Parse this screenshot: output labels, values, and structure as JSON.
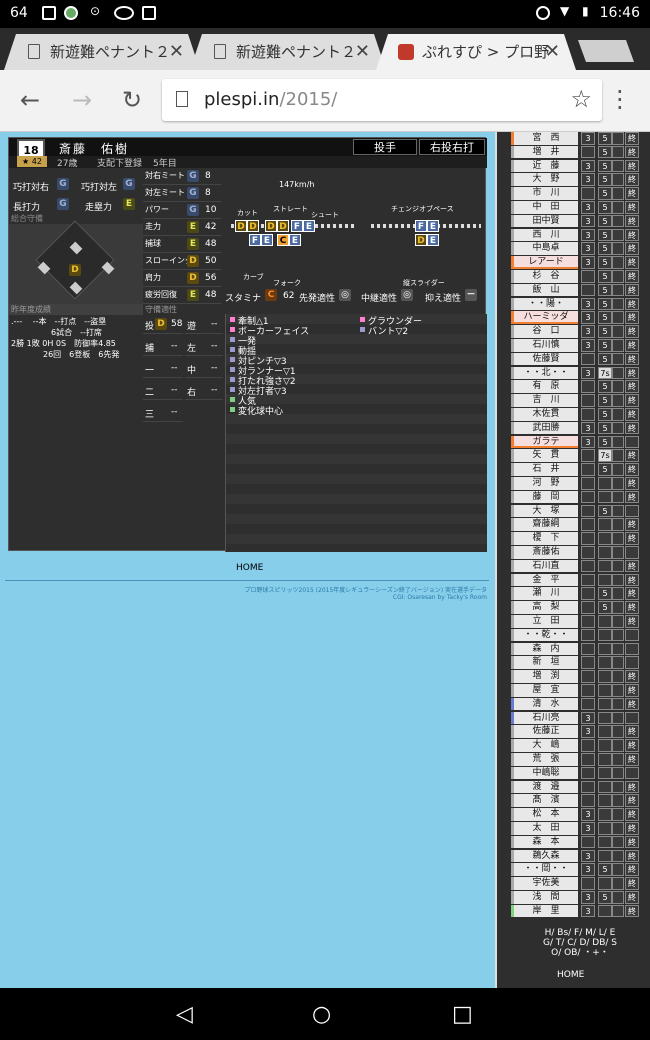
{
  "status": {
    "left": "64",
    "time": "16:46"
  },
  "tabs": [
    {
      "label": "新遊難ペナント２"
    },
    {
      "label": "新遊難ペナント２"
    },
    {
      "label": "ぷれすぴ > プロ野"
    }
  ],
  "url": {
    "host": "plespi.in",
    "path": "/2015/"
  },
  "player": {
    "number": "18",
    "name": "斎藤　佑樹",
    "position": "投手",
    "hand": "右投右打",
    "stars": "★ 42",
    "age": "27歳",
    "reg": "支配下登録",
    "years": "5年目"
  },
  "batting": [
    {
      "label": "巧打対右",
      "grade": "G"
    },
    {
      "label": "巧打対左",
      "grade": "G"
    },
    {
      "label": "長打力",
      "grade": "G"
    },
    {
      "label": "走塁力",
      "grade": "E"
    }
  ],
  "labels": {
    "field": "総合守備",
    "last_year": "昨年度成績",
    "defense_fit": "守備適性",
    "stamina": "スタミナ",
    "starter": "先発適性",
    "reliever": "中継適性",
    "closer": "抑え適性",
    "home": "HOME"
  },
  "record": {
    "l1": ".---　 --本　--打点　--盗塁",
    "l2": "　　　　　6試合　--打席",
    "l3": "2勝 1敗 0H 0S　防御率4.85",
    "l4": "　　　　26回　6登板　6先発"
  },
  "abilities": [
    {
      "label": "対右ミート",
      "grade": "G",
      "value": "8"
    },
    {
      "label": "対左ミート",
      "grade": "G",
      "value": "8"
    },
    {
      "label": "パワー",
      "grade": "G",
      "value": "10"
    },
    {
      "label": "走力",
      "grade": "E",
      "value": "42"
    },
    {
      "label": "捕球",
      "grade": "E",
      "value": "48"
    },
    {
      "label": "スローイング",
      "grade": "D",
      "value": "50"
    },
    {
      "label": "肩力",
      "grade": "D",
      "value": "56"
    },
    {
      "label": "疲労回復",
      "grade": "E",
      "value": "48"
    }
  ],
  "pitching": {
    "speed": "147km/h",
    "cut": "カット",
    "straight": "ストレート",
    "shoot": "シュート",
    "curve": "カーブ",
    "fork": "フォーク",
    "changeup": "チェンジオブペース",
    "slider": "縦スライダー",
    "stamina_grade": "C",
    "stamina_value": "62",
    "starter_mark": "◎",
    "reliever_mark": "◎",
    "closer_mark": "－"
  },
  "positions": {
    "pitch": "投",
    "pitch_grade": "D",
    "pitch_val": "58",
    "ss": "遊",
    "c": "捕",
    "lf": "左",
    "first": "一",
    "cf": "中",
    "second": "二",
    "rf": "右",
    "third": "三",
    "dash": "--"
  },
  "skills": [
    {
      "t": "牽制△1",
      "c": "#ff7fd0"
    },
    {
      "t": "グラウンダー",
      "c": "#ff7fd0"
    },
    {
      "t": "ボーカーフェイス",
      "c": "#ff7fd0"
    },
    {
      "t": "バント▽2",
      "c": "#9a9ad0"
    },
    {
      "t": "一発",
      "c": "#9a9ad0"
    },
    {
      "t": "動揺",
      "c": "#9a9ad0"
    },
    {
      "t": "対ピンチ▽3",
      "c": "#9a9ad0"
    },
    {
      "t": "対ランナー▽1",
      "c": "#9a9ad0"
    },
    {
      "t": "打たれ強さ▽2",
      "c": "#9a9ad0"
    },
    {
      "t": "対左打者▽3",
      "c": "#9a9ad0"
    },
    {
      "t": "人気",
      "c": "#7fd07f"
    },
    {
      "t": "変化球中心",
      "c": "#7fd07f"
    }
  ],
  "footer": {
    "l1": "プロ野球スピリッツ2015 (2015年度レギュラーシーズン終了バージョン) 実在選手データ",
    "l2": "CGI: Osaresan by Tacky's Room"
  },
  "roster": [
    {
      "n": "宮　西",
      "a": "3",
      "b": "5",
      "e": "終",
      "p": 0,
      "k": "#f08030"
    },
    {
      "n": "増　井",
      "a": "",
      "b": "5",
      "e": "終",
      "p": 0,
      "k": "#aaa"
    },
    {
      "n": "近　藤",
      "a": "3",
      "b": "5",
      "e": "終",
      "p": 0,
      "k": "#aaa"
    },
    {
      "n": "大　野",
      "a": "3",
      "b": "5",
      "e": "終",
      "p": 0,
      "k": "#aaa"
    },
    {
      "n": "市　川",
      "a": "",
      "b": "5",
      "e": "終",
      "p": 0,
      "k": "#aaa"
    },
    {
      "n": "中　田",
      "a": "3",
      "b": "5",
      "e": "終",
      "p": 0,
      "k": "#aaa"
    },
    {
      "n": "田中賢",
      "a": "3",
      "b": "5",
      "e": "終",
      "p": 0,
      "k": "#aaa"
    },
    {
      "n": "西　川",
      "a": "3",
      "b": "5",
      "e": "終",
      "p": 0,
      "k": "#aaa"
    },
    {
      "n": "中島卓",
      "a": "3",
      "b": "5",
      "e": "終",
      "p": 0,
      "k": "#aaa"
    },
    {
      "n": "レアード",
      "a": "3",
      "b": "5",
      "e": "終",
      "p": 1,
      "k": "#f08030"
    },
    {
      "n": "杉　谷",
      "a": "",
      "b": "5",
      "e": "終",
      "p": 0,
      "k": "#aaa"
    },
    {
      "n": "飯　山",
      "a": "",
      "b": "5",
      "e": "終",
      "p": 0,
      "k": "#aaa"
    },
    {
      "n": "・・陽・",
      "a": "3",
      "b": "5",
      "e": "終",
      "p": 0,
      "k": "#aaa"
    },
    {
      "n": "ハーミッダ",
      "a": "3",
      "b": "5",
      "e": "終",
      "p": 1,
      "k": "#f08030"
    },
    {
      "n": "谷　口",
      "a": "3",
      "b": "5",
      "e": "終",
      "p": 0,
      "k": "#aaa"
    },
    {
      "n": "石川慎",
      "a": "3",
      "b": "5",
      "e": "終",
      "p": 0,
      "k": "#aaa"
    },
    {
      "n": "佐藤賢",
      "a": "",
      "b": "5",
      "e": "終",
      "p": 0,
      "k": "#aaa"
    },
    {
      "n": "・・北・・",
      "a": "3",
      "b": "7s",
      "e": "終",
      "p": 0,
      "k": "#aaa"
    },
    {
      "n": "有　原",
      "a": "",
      "b": "5",
      "e": "終",
      "p": 0,
      "k": "#aaa"
    },
    {
      "n": "吉　川",
      "a": "",
      "b": "5",
      "e": "終",
      "p": 0,
      "k": "#aaa"
    },
    {
      "n": "木佐貫",
      "a": "",
      "b": "5",
      "e": "終",
      "p": 0,
      "k": "#aaa"
    },
    {
      "n": "武田勝",
      "a": "3",
      "b": "5",
      "e": "終",
      "p": 0,
      "k": "#aaa"
    },
    {
      "n": "ガラテ",
      "a": "3",
      "b": "5",
      "e": "",
      "p": 1,
      "k": "#f08030"
    },
    {
      "n": "矢　貫",
      "a": "",
      "b": "7s",
      "e": "終",
      "p": 0,
      "k": "#aaa"
    },
    {
      "n": "石　井",
      "a": "",
      "b": "5",
      "e": "終",
      "p": 0,
      "k": "#aaa"
    },
    {
      "n": "河　野",
      "a": "",
      "b": "",
      "e": "終",
      "p": 0,
      "k": "#aaa"
    },
    {
      "n": "藤　岡",
      "a": "",
      "b": "",
      "e": "終",
      "p": 0,
      "k": "#aaa"
    },
    {
      "n": "大　塚",
      "a": "",
      "b": "5",
      "e": "",
      "p": 0,
      "k": "#aaa"
    },
    {
      "n": "齋藤綱",
      "a": "",
      "b": "",
      "e": "終",
      "p": 0,
      "k": "#aaa"
    },
    {
      "n": "榎　下",
      "a": "",
      "b": "",
      "e": "終",
      "p": 0,
      "k": "#aaa"
    },
    {
      "n": "斎藤佑",
      "a": "",
      "b": "",
      "e": "",
      "p": 0,
      "k": "#aaa"
    },
    {
      "n": "石川直",
      "a": "",
      "b": "",
      "e": "終",
      "p": 0,
      "k": "#aaa"
    },
    {
      "n": "金　平",
      "a": "",
      "b": "",
      "e": "終",
      "p": 0,
      "k": "#aaa"
    },
    {
      "n": "瀬　川",
      "a": "",
      "b": "5",
      "e": "終",
      "p": 0,
      "k": "#aaa"
    },
    {
      "n": "高　梨",
      "a": "",
      "b": "5",
      "e": "終",
      "p": 0,
      "k": "#aaa"
    },
    {
      "n": "立　田",
      "a": "",
      "b": "",
      "e": "終",
      "p": 0,
      "k": "#aaa"
    },
    {
      "n": "・・乾・・",
      "a": "",
      "b": "",
      "e": "",
      "p": 0,
      "k": "#aaa"
    },
    {
      "n": "森　内",
      "a": "",
      "b": "",
      "e": "",
      "p": 0,
      "k": "#aaa"
    },
    {
      "n": "新　垣",
      "a": "",
      "b": "",
      "e": "",
      "p": 0,
      "k": "#aaa"
    },
    {
      "n": "増　渕",
      "a": "",
      "b": "",
      "e": "終",
      "p": 0,
      "k": "#aaa"
    },
    {
      "n": "屋　宜",
      "a": "",
      "b": "",
      "e": "終",
      "p": 0,
      "k": "#aaa"
    },
    {
      "n": "清　水",
      "a": "",
      "b": "",
      "e": "終",
      "p": 0,
      "k": "#6a7ad0"
    },
    {
      "n": "石川亮",
      "a": "3",
      "b": "",
      "e": "",
      "p": 0,
      "k": "#6a7ad0"
    },
    {
      "n": "佐藤正",
      "a": "3",
      "b": "",
      "e": "終",
      "p": 0,
      "k": "#aaa"
    },
    {
      "n": "大　嶋",
      "a": "",
      "b": "",
      "e": "終",
      "p": 0,
      "k": "#aaa"
    },
    {
      "n": "荒　張",
      "a": "",
      "b": "",
      "e": "終",
      "p": 0,
      "k": "#aaa"
    },
    {
      "n": "中嶋聡",
      "a": "",
      "b": "",
      "e": "",
      "p": 0,
      "k": "#aaa"
    },
    {
      "n": "渡　邉",
      "a": "",
      "b": "",
      "e": "終",
      "p": 0,
      "k": "#aaa"
    },
    {
      "n": "髙　濱",
      "a": "",
      "b": "",
      "e": "終",
      "p": 0,
      "k": "#aaa"
    },
    {
      "n": "松　本",
      "a": "3",
      "b": "",
      "e": "終",
      "p": 0,
      "k": "#aaa"
    },
    {
      "n": "太　田",
      "a": "3",
      "b": "",
      "e": "終",
      "p": 0,
      "k": "#aaa"
    },
    {
      "n": "森　本",
      "a": "",
      "b": "",
      "e": "終",
      "p": 0,
      "k": "#aaa"
    },
    {
      "n": "鵜久森",
      "a": "3",
      "b": "",
      "e": "終",
      "p": 0,
      "k": "#aaa"
    },
    {
      "n": "・・岡・・",
      "a": "3",
      "b": "5",
      "e": "終",
      "p": 0,
      "k": "#aaa"
    },
    {
      "n": "宇佐美",
      "a": "",
      "b": "",
      "e": "終",
      "p": 0,
      "k": "#aaa"
    },
    {
      "n": "浅　間",
      "a": "3",
      "b": "5",
      "e": "終",
      "p": 0,
      "k": "#aaa"
    },
    {
      "n": "岸　里",
      "a": "3",
      "b": "",
      "e": "終",
      "p": 0,
      "k": "#7fd07f"
    }
  ],
  "legend": {
    "l1": "H/ Bs/ F/ M/ L/ E",
    "l2": "G/ T/ C/ D/ DB/ S",
    "l3": "O/ OB/ ・+・"
  }
}
